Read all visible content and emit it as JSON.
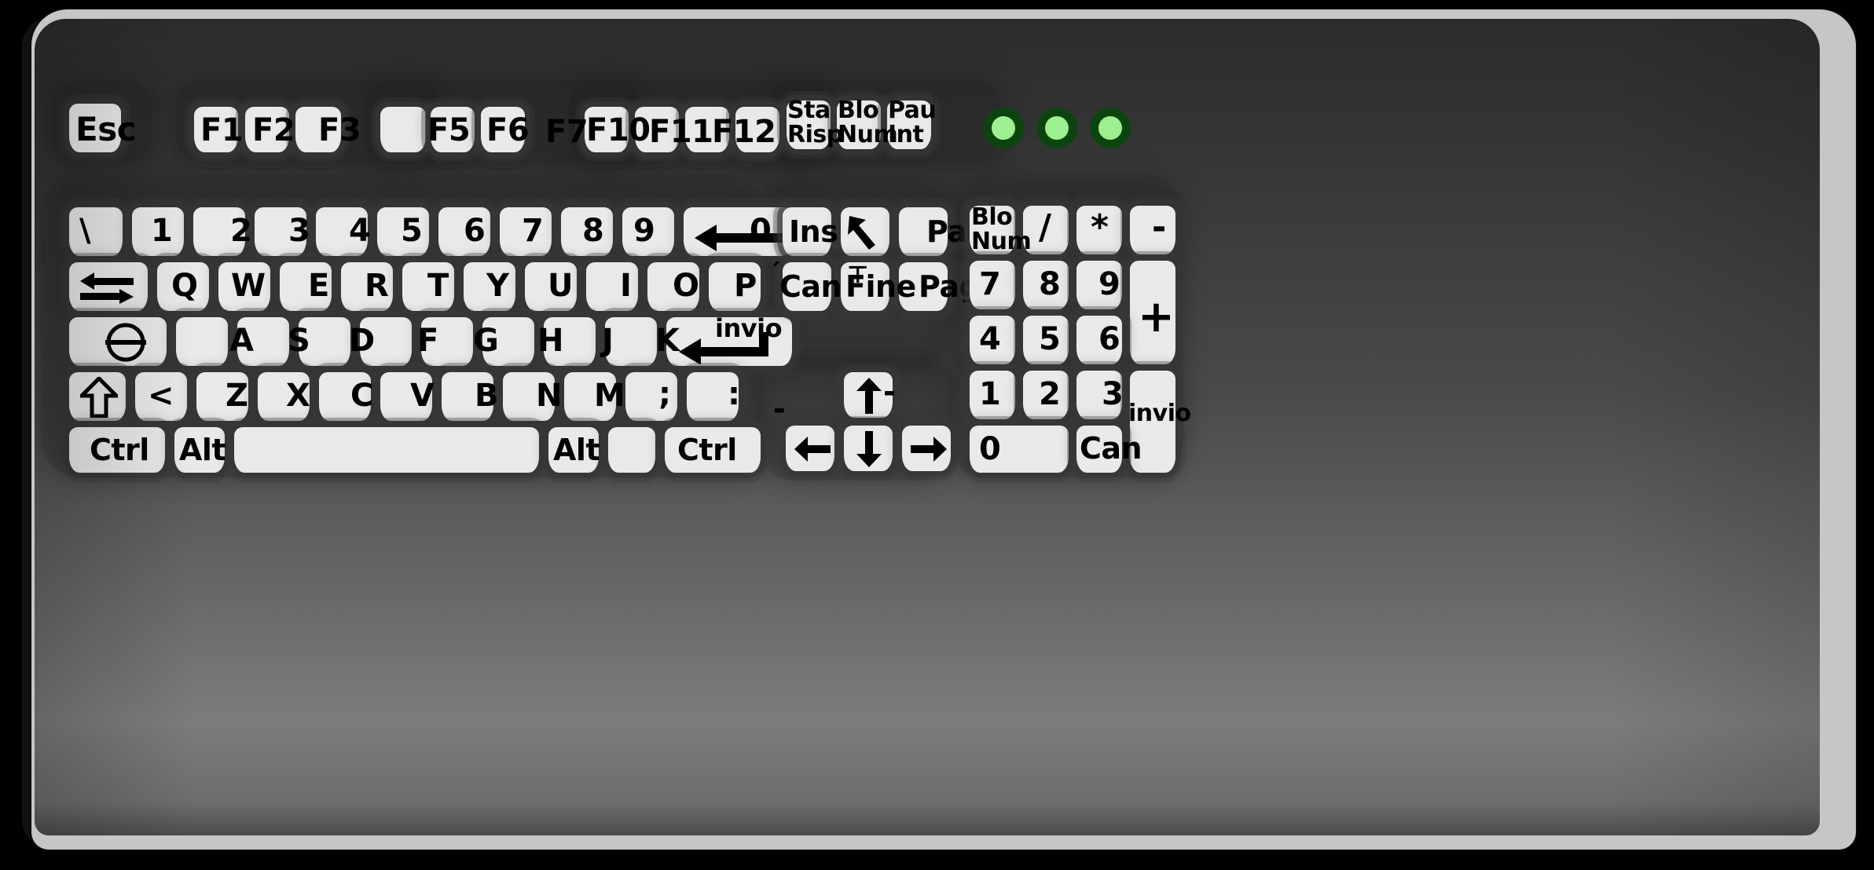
{
  "device": {
    "type": "keyboard",
    "layout": "Italian (IT) 102-key PC keyboard",
    "case_color": "#4a4a4a",
    "bezel_color": "#c6c6c6",
    "key_color": "#e9e9e9",
    "legend_color": "#000000",
    "background_color": "#000000"
  },
  "indicators": {
    "color_on": "#9df08f",
    "ring_color": "#0c4410",
    "lights": [
      {
        "name": "led-1"
      },
      {
        "name": "led-2"
      },
      {
        "name": "led-3"
      }
    ]
  },
  "function_row": {
    "keys": [
      {
        "id": "esc",
        "label": "Esc"
      },
      {
        "id": "f1",
        "label": "F1"
      },
      {
        "id": "f2",
        "label": "F2"
      },
      {
        "id": "f3",
        "label": "F3"
      },
      {
        "id": "f4",
        "label": ""
      },
      {
        "id": "f5",
        "label": "F5"
      },
      {
        "id": "f6",
        "label": "F6"
      },
      {
        "id": "f7",
        "label": "F7"
      },
      {
        "id": "f10",
        "label": "F10"
      },
      {
        "id": "f11",
        "label": "F11"
      },
      {
        "id": "f12",
        "label": "F12"
      },
      {
        "id": "stamp",
        "label": "Sta\nRisp"
      },
      {
        "id": "blocnum_sys",
        "label": "Blo\nNum"
      },
      {
        "id": "pause",
        "label": "Pau\nInt"
      }
    ]
  },
  "number_row": {
    "keys": [
      {
        "id": "backslash",
        "label": "\\"
      },
      {
        "id": "d1",
        "label": "1"
      },
      {
        "id": "d2",
        "label": "2"
      },
      {
        "id": "d3",
        "label": "3"
      },
      {
        "id": "d4",
        "label": "4"
      },
      {
        "id": "d5",
        "label": "5"
      },
      {
        "id": "d6",
        "label": "6"
      },
      {
        "id": "d7",
        "label": "7"
      },
      {
        "id": "d8",
        "label": "8"
      },
      {
        "id": "d9",
        "label": "9"
      },
      {
        "id": "d0",
        "label": "0"
      },
      {
        "id": "backspace",
        "label": "",
        "icon": "arrow-left-long-icon"
      }
    ]
  },
  "tab_row": {
    "keys": [
      {
        "id": "tab",
        "label": "",
        "icon": "tab-arrows-icon"
      },
      {
        "id": "q",
        "label": "Q"
      },
      {
        "id": "w",
        "label": "W"
      },
      {
        "id": "e",
        "label": "E"
      },
      {
        "id": "r",
        "label": "R"
      },
      {
        "id": "t",
        "label": "T"
      },
      {
        "id": "y",
        "label": "Y"
      },
      {
        "id": "u",
        "label": "U"
      },
      {
        "id": "i",
        "label": "I"
      },
      {
        "id": "o",
        "label": "O"
      },
      {
        "id": "p",
        "label": "P"
      }
    ]
  },
  "home_row": {
    "keys": [
      {
        "id": "capslock",
        "label": "",
        "icon": "capslock-circle-icon"
      },
      {
        "id": "a",
        "label": "A"
      },
      {
        "id": "s",
        "label": "S"
      },
      {
        "id": "d",
        "label": "D"
      },
      {
        "id": "f",
        "label": "F"
      },
      {
        "id": "g",
        "label": "G"
      },
      {
        "id": "h",
        "label": "H"
      },
      {
        "id": "j",
        "label": "J"
      },
      {
        "id": "k",
        "label": "K"
      },
      {
        "id": "enter",
        "label": "invio",
        "icon": "enter-arrow-icon"
      }
    ]
  },
  "shift_row": {
    "keys": [
      {
        "id": "lshift",
        "label": "",
        "icon": "shift-up-arrow-icon"
      },
      {
        "id": "less",
        "label": "<"
      },
      {
        "id": "z",
        "label": "Z"
      },
      {
        "id": "x",
        "label": "X"
      },
      {
        "id": "c",
        "label": "C"
      },
      {
        "id": "v",
        "label": "V"
      },
      {
        "id": "b",
        "label": "B"
      },
      {
        "id": "n",
        "label": "N"
      },
      {
        "id": "m",
        "label": "M"
      },
      {
        "id": "semicolon",
        "label": ";"
      },
      {
        "id": "colon",
        "label": ":"
      }
    ]
  },
  "bottom_row": {
    "keys": [
      {
        "id": "lctrl",
        "label": "Ctrl"
      },
      {
        "id": "lalt",
        "label": "Alt"
      },
      {
        "id": "space",
        "label": ""
      },
      {
        "id": "ralt",
        "label": "Alt"
      },
      {
        "id": "menu",
        "label": ""
      },
      {
        "id": "rctrl",
        "label": "Ctrl"
      }
    ]
  },
  "nav_cluster": {
    "keys": [
      {
        "id": "ins",
        "label": "Ins"
      },
      {
        "id": "home",
        "label": "",
        "icon": "home-diagonal-arrow-icon"
      },
      {
        "id": "pageup",
        "label": "Pag"
      },
      {
        "id": "canc",
        "label": "Can"
      },
      {
        "id": "fine",
        "label": "Fine"
      },
      {
        "id": "pagedown",
        "label": "Pag"
      },
      {
        "id": "arrow-up",
        "label": "",
        "icon": "arrow-up-icon"
      },
      {
        "id": "arrow-left",
        "label": "",
        "icon": "arrow-left-icon"
      },
      {
        "id": "arrow-down",
        "label": "",
        "icon": "arrow-down-icon"
      },
      {
        "id": "arrow-right",
        "label": "",
        "icon": "arrow-right-icon"
      }
    ],
    "stray_marks": [
      "-",
      "-"
    ]
  },
  "numpad": {
    "keys": [
      {
        "id": "numlock",
        "label": "Blo\nNum"
      },
      {
        "id": "divide",
        "label": "/"
      },
      {
        "id": "multiply",
        "label": "*"
      },
      {
        "id": "minus",
        "label": "-"
      },
      {
        "id": "n7",
        "label": "7"
      },
      {
        "id": "n8",
        "label": "8"
      },
      {
        "id": "n9",
        "label": "9"
      },
      {
        "id": "plus",
        "label": "+"
      },
      {
        "id": "n4",
        "label": "4"
      },
      {
        "id": "n5",
        "label": "5"
      },
      {
        "id": "n6",
        "label": "6"
      },
      {
        "id": "n1",
        "label": "1"
      },
      {
        "id": "n2",
        "label": "2"
      },
      {
        "id": "n3",
        "label": "3"
      },
      {
        "id": "numenter",
        "label": "invio"
      },
      {
        "id": "n0",
        "label": "0"
      },
      {
        "id": "numcanc",
        "label": "Can"
      }
    ]
  }
}
